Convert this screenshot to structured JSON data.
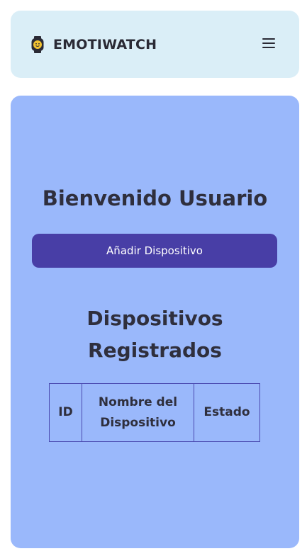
{
  "navbar": {
    "brand_name": "EMOTIWATCH",
    "logo_icon": "smartwatch-icon",
    "menu_icon": "hamburger-menu-icon"
  },
  "main": {
    "welcome_text": "Bienvenido Usuario",
    "add_device_label": "Añadir Dispositivo",
    "section_title_line1": "Dispositivos",
    "section_title_line2": "Registrados",
    "table": {
      "headers": {
        "id": "ID",
        "name_line1": "Nombre del",
        "name_line2": "Dispositivo",
        "state": "Estado"
      },
      "rows": []
    }
  },
  "colors": {
    "navbar_bg": "#daeef7",
    "card_bg": "#9ab8fb",
    "button_bg": "#483ea6",
    "text_dark": "#2f2f3d",
    "table_border": "#4a4ab0"
  }
}
